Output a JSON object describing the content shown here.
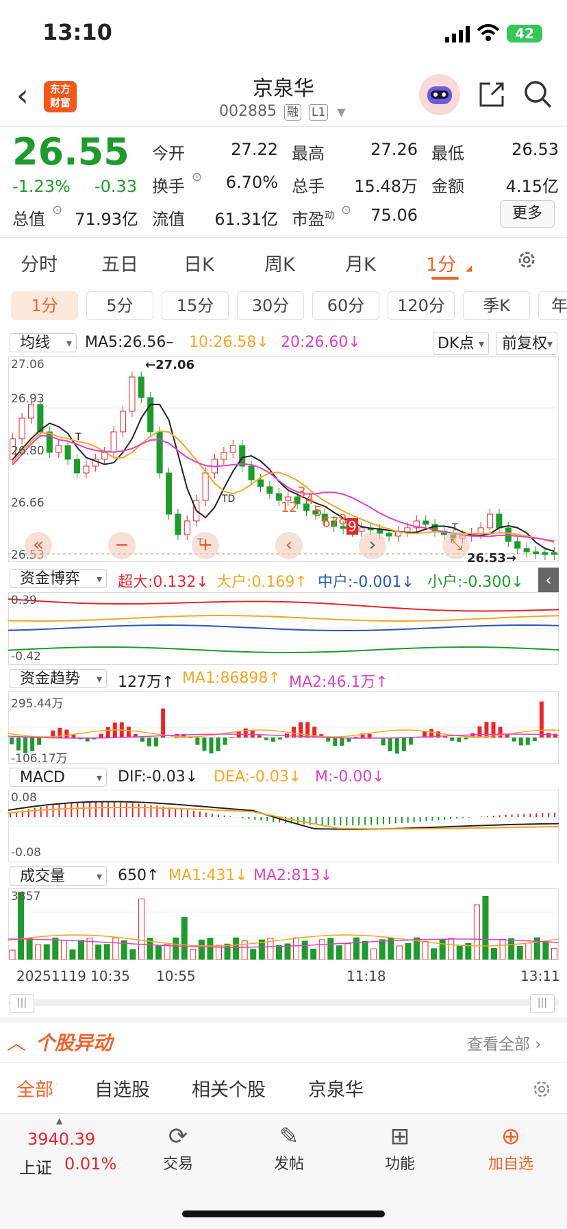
{
  "status_bar": {
    "time": "13:10",
    "battery": "42"
  },
  "header": {
    "title": "京泉华",
    "code": "002885",
    "tag1": "融",
    "tag2": "L1",
    "logo_line1": "东方",
    "logo_line2": "财富"
  },
  "quote": {
    "price": "26.55",
    "change_pct": "-1.23%",
    "change": "-0.33",
    "open_label": "今开",
    "open": "27.22",
    "high_label": "最高",
    "high": "27.26",
    "low_label": "最低",
    "low": "26.53",
    "turnover_label": "换手",
    "turnover": "6.70%",
    "volume_label": "总手",
    "volume": "15.48万",
    "amount_label": "金额",
    "amount": "4.15亿",
    "mktcap_label": "总值",
    "mktcap": "71.93亿",
    "float_label": "流值",
    "float": "61.31亿",
    "pe_label": "市盈",
    "pe_sup": "动",
    "pe": "75.06",
    "more": "更多"
  },
  "period_tabs": [
    "分时",
    "五日",
    "日K",
    "周K",
    "月K",
    "1分"
  ],
  "minute_chips": [
    "1分",
    "5分",
    "15分",
    "30分",
    "60分",
    "120分",
    "季K",
    "年"
  ],
  "ma_row": {
    "selector": "均线",
    "ma5": "MA5:26.56–",
    "ma10": "10:26.58↓",
    "ma20": "20:26.60↓",
    "dk": "DK点",
    "fq": "前复权"
  },
  "kline": {
    "y_labels": [
      "27.06",
      "26.93",
      "26.80",
      "26.66",
      "26.53"
    ],
    "peak_label": "←27.06",
    "low_label": "26.53→",
    "nums": [
      "1",
      "2",
      "3",
      "4",
      "5",
      "6",
      "7",
      "8",
      "9"
    ],
    "td": [
      "T",
      "TD",
      "T",
      "T"
    ],
    "colors": {
      "up": "#e8262a",
      "down": "#1f9a2c",
      "ma5": "#222222",
      "ma10": "#f5a623",
      "ma20": "#e040c8"
    }
  },
  "fund_game": {
    "selector": "资金博弈",
    "super": "超大:0.132↓",
    "big": "大户:0.169↑",
    "mid": "中户:-0.001↓",
    "small": "小户:-0.300↓",
    "y_top": "0.39",
    "y_bottom": "-0.42"
  },
  "fund_trend": {
    "selector": "资金趋势",
    "value": "127万↑",
    "ma1": "MA1:86898↑",
    "ma2": "MA2:46.1万↑",
    "y_top": "295.44万",
    "y_bottom": "-106.17万"
  },
  "macd": {
    "selector": "MACD",
    "dif": "DIF:-0.03↓",
    "dea": "DEA:-0.03↓",
    "m": "M:-0.00↓",
    "y_top": "0.08",
    "y_bottom": "-0.08"
  },
  "vol": {
    "selector": "成交量",
    "value": "650↑",
    "ma1": "MA1:431↓",
    "ma2": "MA2:813↓",
    "y_top": "3857"
  },
  "time_axis": [
    "20251119 10:35",
    "10:55",
    "11:18",
    "13:11"
  ],
  "abnormal": {
    "title": "个股异动",
    "view_all": "查看全部"
  },
  "news_tabs": [
    "全部",
    "自选股",
    "相关个股",
    "京泉华"
  ],
  "index": {
    "value": "3940.39",
    "name": "上证",
    "pct": "0.01%"
  },
  "bottom_nav": [
    "交易",
    "发帖",
    "功能",
    "加自选"
  ]
}
